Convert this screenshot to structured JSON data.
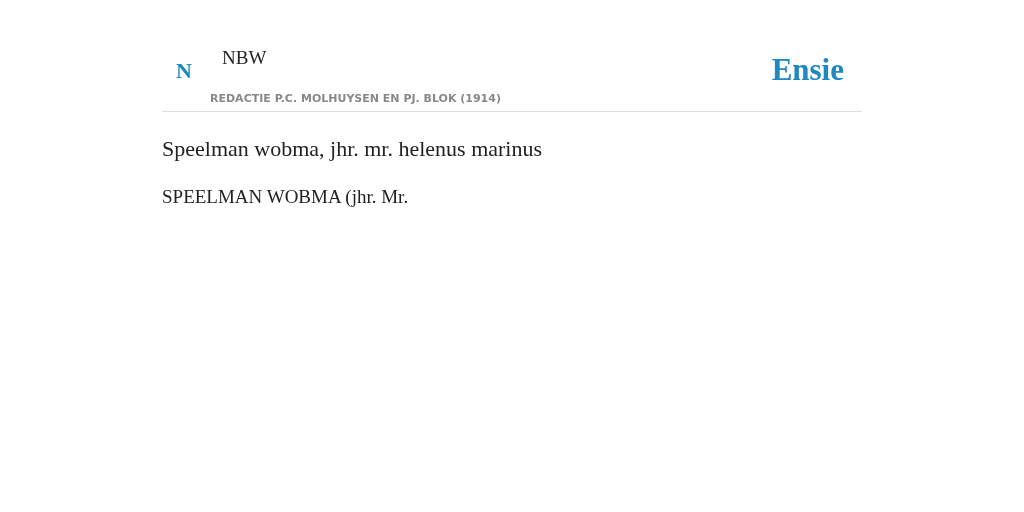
{
  "header": {
    "initial": "N",
    "source": "NBW",
    "editors": "REDACTIE P.C. MOLHUYSEN EN PJ. BLOK (1914)",
    "brand": "Ensie"
  },
  "title": "Speelman wobma, jhr. mr. helenus marinus",
  "body": "SPEELMAN WOBMA (jhr. Mr."
}
